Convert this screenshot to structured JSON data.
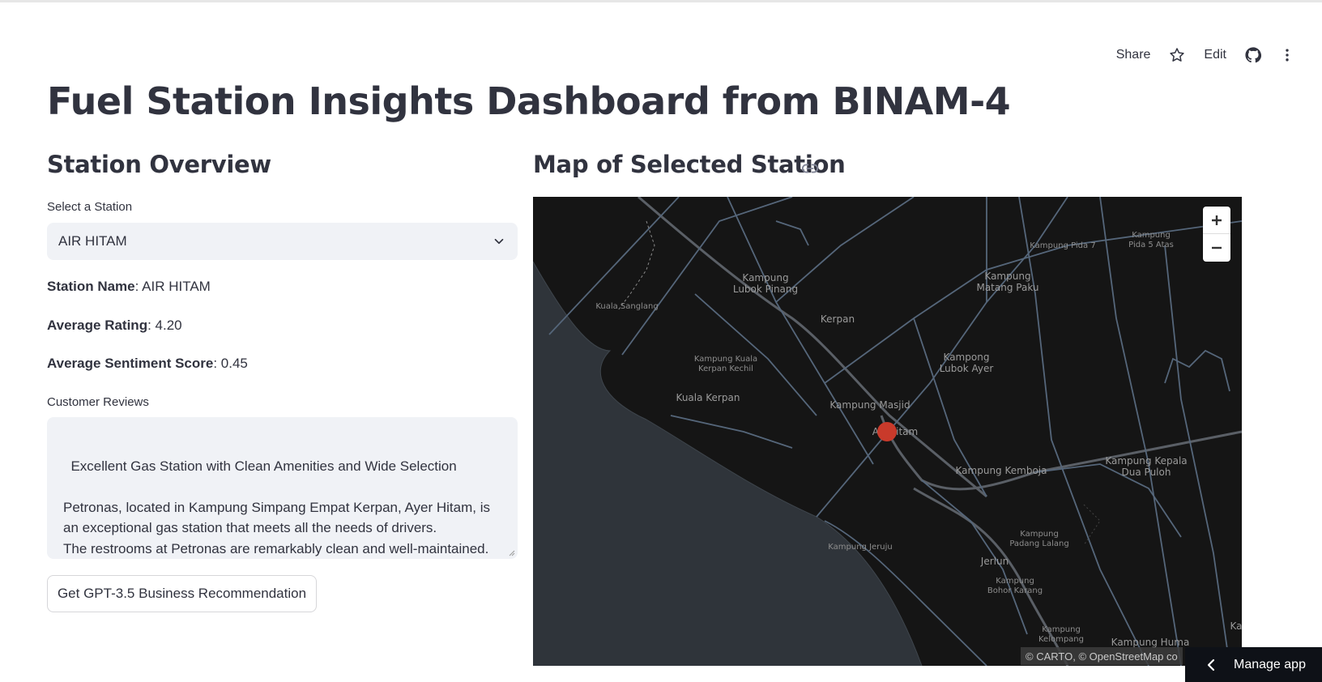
{
  "toolbar": {
    "share": "Share",
    "edit": "Edit"
  },
  "title": "Fuel Station Insights Dashboard from BINAM-4",
  "left": {
    "heading": "Station Overview",
    "select_label": "Select a Station",
    "select_value": "AIR HITAM",
    "station_name_label": "Station Name",
    "station_name_value": ": AIR HITAM",
    "avg_rating_label": "Average Rating",
    "avg_rating_value": ": 4.20",
    "avg_sentiment_label": "Average Sentiment Score",
    "avg_sentiment_value": ": 0.45",
    "reviews_label": "Customer Reviews",
    "reviews_text": "Excellent Gas Station with Clean Amenities and Wide Selection\n\nPetronas, located in Kampung Simpang Empat Kerpan, Ayer Hitam, is an exceptional gas station that meets all the needs of drivers.\nThe restrooms at Petronas are remarkably clean and well-maintained. This is a crucial aspect that many gas stations often",
    "button": "Get GPT-3.5 Business Recommendation"
  },
  "right": {
    "heading": "Map of Selected Station",
    "attribution": "© CARTO, © OpenStreetMap co",
    "places": {
      "p1": "Kampung Pida 7",
      "p2a": "Kampung",
      "p2b": "Pida 5 Atas",
      "p3a": "Kampung",
      "p3b": "Lubok Pinang",
      "p4a": "Kampung",
      "p4b": "Matang Paku",
      "p5": "Kuala Sanglang",
      "p6": "Kerpan",
      "p7a": "Kampung Kuala",
      "p7b": "Kerpan Kechil",
      "p8a": "Kampong",
      "p8b": "Lubok Ayer",
      "p9": "Kuala Kerpan",
      "p10": "Kampung Masjid",
      "p11": "Air Hitam",
      "p12": "Kampung Kemboja",
      "p13a": "Kampung Kepala",
      "p13b": "Dua Puloh",
      "p14": "Kampung Jeruju",
      "p15a": "Kampung",
      "p15b": "Padang Lalang",
      "p16": "Jerlun",
      "p17a": "Kampung",
      "p17b": "Bohor Karang",
      "p18a": "Kampung",
      "p18b": "Kelompang",
      "p19": "Kampung Huma",
      "p20": "Ka"
    },
    "marker_color": "#c93a2b"
  },
  "manage_app": "Manage app",
  "icons": [
    "star-icon",
    "github-icon",
    "more-vertical-icon",
    "chevron-down-icon",
    "link-icon",
    "zoom-in-icon",
    "zoom-out-icon",
    "chevron-left-icon"
  ]
}
